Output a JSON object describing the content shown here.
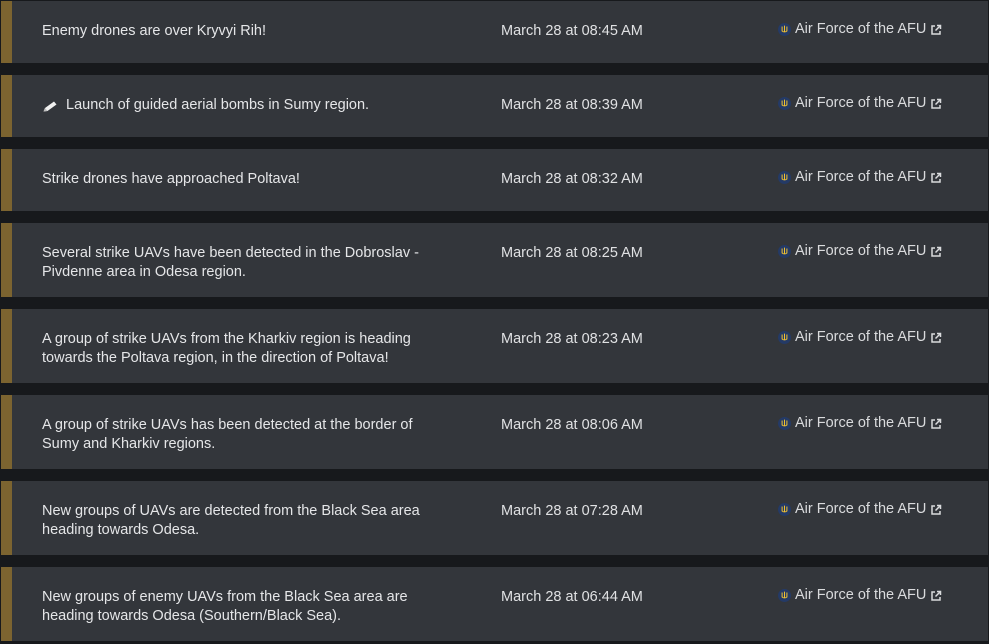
{
  "colors": {
    "page_background": "#17191c",
    "card_background": "#33363b",
    "accent_bar": "#7c6430",
    "text": "#e5e6e8"
  },
  "icons": {
    "emblem": "ukraine-trident-icon",
    "external": "external-link-icon",
    "message_marker": "pencil-icon"
  },
  "alerts": [
    {
      "lines": [
        "Enemy drones are over Kryvyi Rih!"
      ],
      "time": "March 28 at 08:45 AM",
      "source": "Air Force of the AFU"
    },
    {
      "lines": [
        "Launch of guided aerial bombs in Sumy region."
      ],
      "time": "March 28 at 08:39 AM",
      "source": "Air Force of the AFU",
      "marker": "pencil-icon"
    },
    {
      "lines": [
        "Strike drones have approached Poltava!"
      ],
      "time": "March 28 at 08:32 AM",
      "source": "Air Force of the AFU"
    },
    {
      "lines": [
        "Several strike UAVs have been detected in the Dobroslav -",
        "Pivdenne area in Odesa region."
      ],
      "time": "March 28 at 08:25 AM",
      "source": "Air Force of the AFU"
    },
    {
      "lines": [
        "A group of strike UAVs from the Kharkiv region is heading",
        "towards the Poltava region, in the direction of Poltava!"
      ],
      "time": "March 28 at 08:23 AM",
      "source": "Air Force of the AFU"
    },
    {
      "lines": [
        "A group of strike UAVs has been detected at the border of",
        "Sumy and Kharkiv regions."
      ],
      "time": "March 28 at 08:06 AM",
      "source": "Air Force of the AFU"
    },
    {
      "lines": [
        "New groups of UAVs are detected from the Black Sea area",
        "heading towards Odesa."
      ],
      "time": "March 28 at 07:28 AM",
      "source": "Air Force of the AFU"
    },
    {
      "lines": [
        "New groups of enemy UAVs from the Black Sea area are",
        "heading towards Odesa (Southern/Black Sea)."
      ],
      "time": "March 28 at 06:44 AM",
      "source": "Air Force of the AFU"
    }
  ]
}
